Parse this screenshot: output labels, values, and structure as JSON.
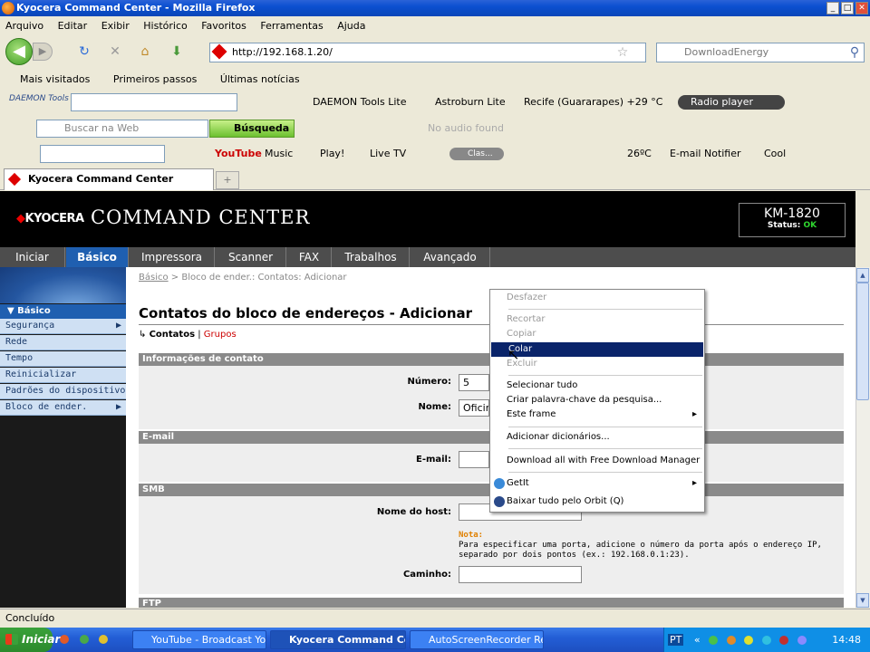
{
  "window": {
    "title": "Kyocera Command Center - Mozilla Firefox"
  },
  "menu": [
    "Arquivo",
    "Editar",
    "Exibir",
    "Histórico",
    "Favoritos",
    "Ferramentas",
    "Ajuda"
  ],
  "nav": {
    "url": "http://192.168.1.20/",
    "search_placeholder": "DownloadEnergy"
  },
  "bookmarks": [
    "Mais visitados",
    "Primeiros passos",
    "Últimas notícias"
  ],
  "toolbar1": {
    "brand": "DAEMON Tools",
    "items": [
      "DAEMON Tools Lite",
      "Astroburn Lite",
      "Recife (Guararapes) +29 °C",
      "Radio player"
    ]
  },
  "toolbar2": {
    "search_placeholder": "Buscar na Web",
    "search_button": "Búsqueda",
    "audio": "No audio found"
  },
  "toolbar3": {
    "items": [
      "Music",
      "Play!",
      "Live TV",
      "Clas...",
      "26ºC",
      "E-mail Notifier",
      "Cool"
    ],
    "youtube": "YouTube"
  },
  "tab": {
    "title": "Kyocera Command Center"
  },
  "header": {
    "logo": "KYOCERA",
    "title": "COMMAND CENTER",
    "model": "KM-1820",
    "status_label": "Status:",
    "status_value": "OK"
  },
  "topnav": [
    "Iniciar",
    "Básico",
    "Impressora",
    "Scanner",
    "FAX",
    "Trabalhos",
    "Avançado"
  ],
  "sidebar": {
    "head": "Básico",
    "items": [
      "Segurança",
      "Rede",
      "Tempo",
      "Reinicializar",
      "Padrões do dispositivo",
      "Bloco de ender."
    ]
  },
  "breadcrumb": {
    "link": "Básico",
    "sep": ">",
    "rest": "Bloco de ender.: Contatos: Adicionar"
  },
  "page": {
    "title": "Contatos do bloco de endereços - Adicionar",
    "tab_current": "Contatos",
    "tab_sep": "|",
    "tab_link": "Grupos"
  },
  "sections": {
    "contact": "Informações de contato",
    "email": "E-mail",
    "smb": "SMB",
    "ftp": "FTP"
  },
  "form": {
    "numero_label": "Número:",
    "numero_value": "5",
    "nome_label": "Nome:",
    "nome_value": "Oficin",
    "email_label": "E-mail:",
    "host_label": "Nome do host:",
    "note_title": "Nota:",
    "note_line1": "Para especificar uma porta, adicione o número da porta após o endereço IP,",
    "note_line2": "separado por dois pontos (ex.: 192.168.0.1:23).",
    "caminho_label": "Caminho:"
  },
  "context_menu": {
    "undo": "Desfazer",
    "cut": "Recortar",
    "copy": "Copiar",
    "paste": "Colar",
    "delete": "Excluir",
    "select_all": "Selecionar tudo",
    "keyword": "Criar palavra-chave da pesquisa...",
    "frame": "Este frame",
    "dict": "Adicionar dicionários...",
    "fdm": "Download all with Free Download Manager",
    "getit": "GetIt",
    "orbit": "Baixar tudo pelo Orbit (Q)"
  },
  "status": {
    "text": "Concluído"
  },
  "taskbar": {
    "start": "Iniciar",
    "tasks": [
      "YouTube - Broadcast Yo...",
      "Kyocera Command Ce...",
      "AutoScreenRecorder Re..."
    ],
    "lang": "PT",
    "clock": "14:48"
  }
}
